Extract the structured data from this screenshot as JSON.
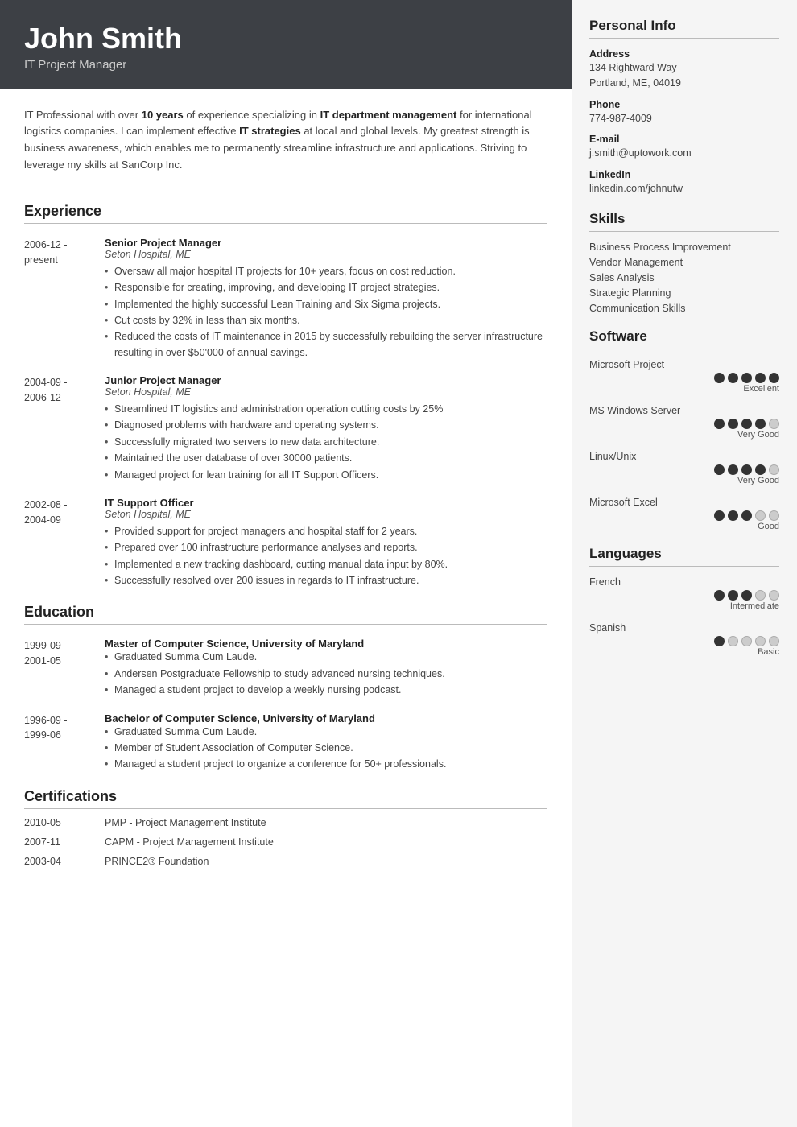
{
  "header": {
    "name": "John Smith",
    "title": "IT Project Manager"
  },
  "summary": {
    "text_parts": [
      {
        "text": "IT Professional with over ",
        "bold": false
      },
      {
        "text": "10 years",
        "bold": true
      },
      {
        "text": " of experience specializing in ",
        "bold": false
      },
      {
        "text": "IT department management",
        "bold": true
      },
      {
        "text": " for international logistics companies. I can implement effective ",
        "bold": false
      },
      {
        "text": "IT strategies",
        "bold": true
      },
      {
        "text": " at local and global levels. My greatest strength is business awareness, which enables me to permanently streamline infrastructure and applications. Striving to leverage my skills at SanCorp Inc.",
        "bold": false
      }
    ]
  },
  "sections": {
    "experience_label": "Experience",
    "education_label": "Education",
    "certifications_label": "Certifications"
  },
  "experience": [
    {
      "date_start": "2006-12 -",
      "date_end": "present",
      "title": "Senior Project Manager",
      "company": "Seton Hospital, ME",
      "bullets": [
        "Oversaw all major hospital IT projects for 10+ years, focus on cost reduction.",
        "Responsible for creating, improving, and developing IT project strategies.",
        "Implemented the highly successful Lean Training and Six Sigma projects.",
        "Cut costs by 32% in less than six months.",
        "Reduced the costs of IT maintenance in 2015 by successfully rebuilding the server infrastructure resulting in over $50'000 of annual savings."
      ]
    },
    {
      "date_start": "2004-09 -",
      "date_end": "2006-12",
      "title": "Junior Project Manager",
      "company": "Seton Hospital, ME",
      "bullets": [
        "Streamlined IT logistics and administration operation cutting costs by 25%",
        "Diagnosed problems with hardware and operating systems.",
        "Successfully migrated two servers to new data architecture.",
        "Maintained the user database of over 30000 patients.",
        "Managed project for lean training for all IT Support Officers."
      ]
    },
    {
      "date_start": "2002-08 -",
      "date_end": "2004-09",
      "title": "IT Support Officer",
      "company": "Seton Hospital, ME",
      "bullets": [
        "Provided support for project managers and hospital staff for 2 years.",
        "Prepared over 100 infrastructure performance analyses and reports.",
        "Implemented a new tracking dashboard, cutting manual data input by 80%.",
        "Successfully resolved over 200 issues in regards to IT infrastructure."
      ]
    }
  ],
  "education": [
    {
      "date_start": "1999-09 -",
      "date_end": "2001-05",
      "title": "Master of Computer Science, University of Maryland",
      "bullets": [
        "Graduated Summa Cum Laude.",
        "Andersen Postgraduate Fellowship to study advanced nursing techniques.",
        "Managed a student project to develop a weekly nursing podcast."
      ]
    },
    {
      "date_start": "1996-09 -",
      "date_end": "1999-06",
      "title": "Bachelor of Computer Science, University of Maryland",
      "bullets": [
        "Graduated Summa Cum Laude.",
        "Member of Student Association of Computer Science.",
        "Managed a student project to organize a conference for 50+ professionals."
      ]
    }
  ],
  "certifications": [
    {
      "date": "2010-05",
      "name": "PMP - Project Management Institute"
    },
    {
      "date": "2007-11",
      "name": "CAPM - Project Management Institute"
    },
    {
      "date": "2003-04",
      "name": "PRINCE2® Foundation"
    }
  ],
  "personal_info": {
    "section_label": "Personal Info",
    "address_label": "Address",
    "address_value": "134 Rightward Way\nPortland, ME, 04019",
    "phone_label": "Phone",
    "phone_value": "774-987-4009",
    "email_label": "E-mail",
    "email_value": "j.smith@uptowork.com",
    "linkedin_label": "LinkedIn",
    "linkedin_value": "linkedin.com/johnutw"
  },
  "skills": {
    "section_label": "Skills",
    "items": [
      "Business Process Improvement",
      "Vendor Management",
      "Sales Analysis",
      "Strategic Planning",
      "Communication Skills"
    ]
  },
  "software": {
    "section_label": "Software",
    "items": [
      {
        "name": "Microsoft Project",
        "filled": 5,
        "total": 5,
        "label": "Excellent"
      },
      {
        "name": "MS Windows Server",
        "filled": 4,
        "total": 5,
        "label": "Very Good"
      },
      {
        "name": "Linux/Unix",
        "filled": 4,
        "total": 5,
        "label": "Very Good"
      },
      {
        "name": "Microsoft Excel",
        "filled": 3,
        "total": 5,
        "label": "Good"
      }
    ]
  },
  "languages": {
    "section_label": "Languages",
    "items": [
      {
        "name": "French",
        "filled": 3,
        "total": 5,
        "label": "Intermediate"
      },
      {
        "name": "Spanish",
        "filled": 1,
        "total": 5,
        "label": "Basic"
      }
    ]
  }
}
